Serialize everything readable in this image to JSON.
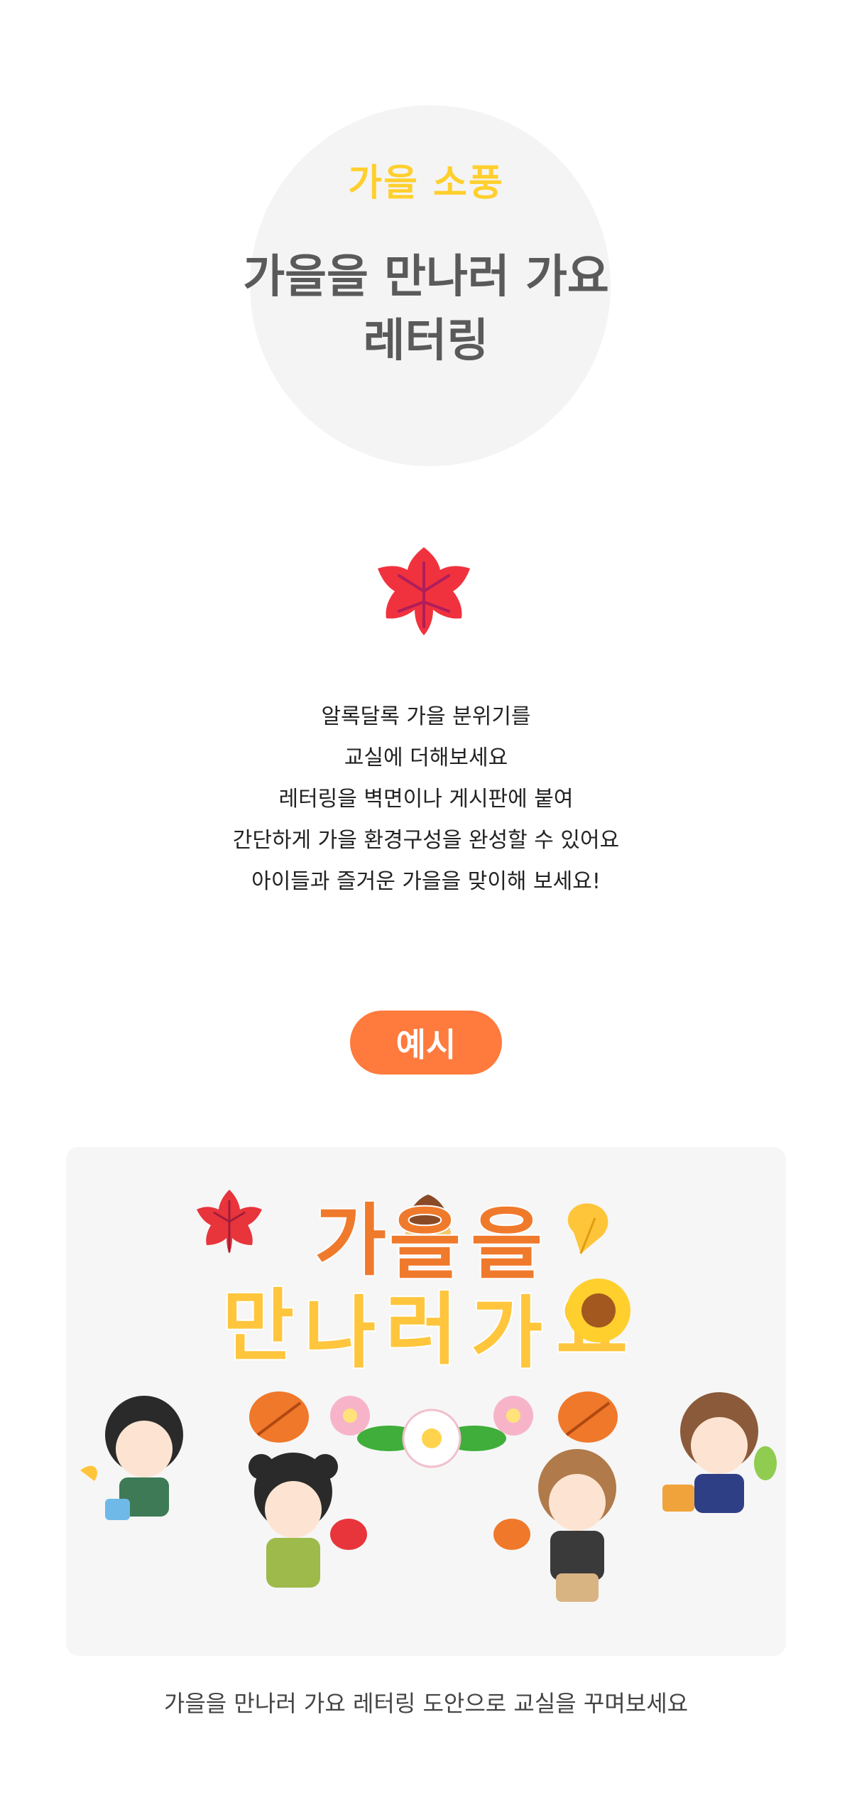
{
  "hero": {
    "subtitle": "가을 소풍",
    "title_line1": "가을을 만나러 가요",
    "title_line2": "레터링"
  },
  "icons": {
    "decor": "maple-leaf-icon"
  },
  "description": [
    "알록달록 가을 분위기를",
    "교실에 더해보세요",
    "레터링을 벽면이나 게시판에 붙여",
    "간단하게 가을 환경구성을 완성할 수 있어요",
    "아이들과 즐거운 가을을 맞이해 보세요!"
  ],
  "example": {
    "label": "예시",
    "lettering": {
      "line1": [
        "가",
        "을",
        "을"
      ],
      "line2": [
        "만",
        "나",
        "러",
        "가",
        "요"
      ]
    }
  },
  "caption": "가을을 만나러 가요 레터링 도안으로 교실을 꾸며보세요",
  "colors": {
    "accent": "#ff7a3d",
    "yellow": "#ffcf2e",
    "title": "#5a5a5a",
    "leaf_red": "#f0323f",
    "panel_bg": "#f6f6f6"
  }
}
